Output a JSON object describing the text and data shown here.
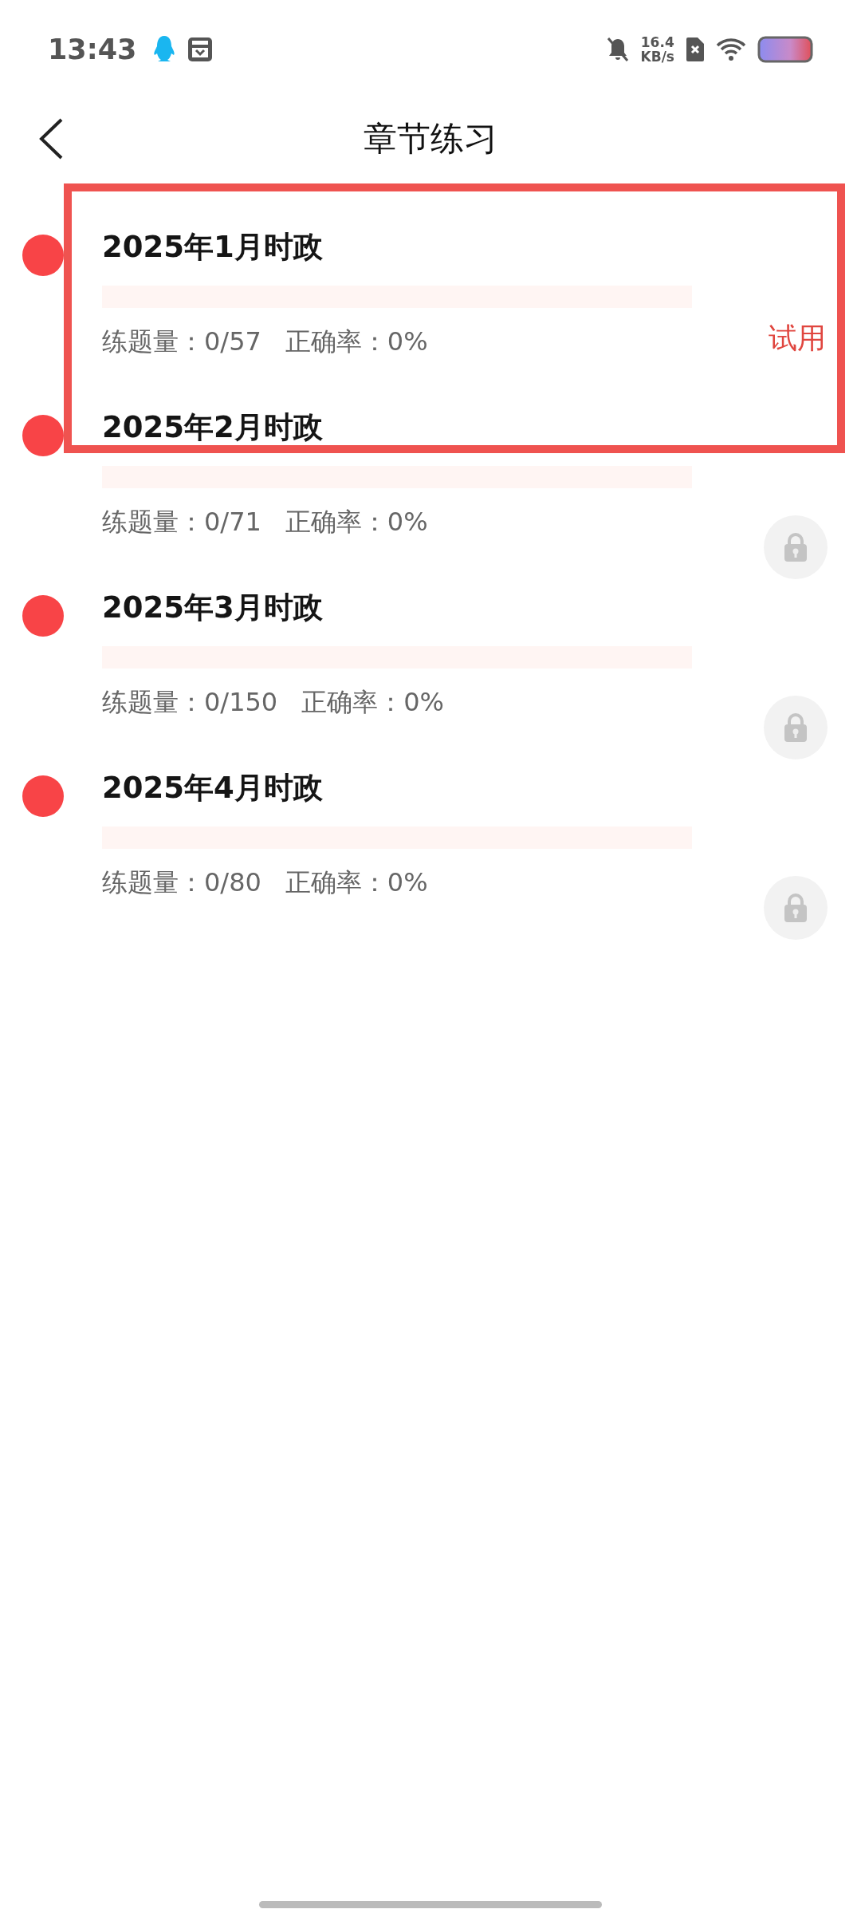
{
  "status_bar": {
    "time": "13:43",
    "net_speed": "16.4",
    "net_unit": "KB/s"
  },
  "header": {
    "title": "章节练习"
  },
  "chapters": [
    {
      "title": "2025年1月时政",
      "level": 0,
      "count_label": "练题量：0/57",
      "accuracy_label": "正确率：0%",
      "kind": "trial",
      "badge": "试用",
      "highlighted": true
    },
    {
      "title": "2025年2月时政",
      "level": 0,
      "count_label": "练题量：0/71",
      "accuracy_label": "正确率：0%",
      "kind": "locked",
      "highlighted": false
    },
    {
      "title": "2025年3月时政",
      "level": 0,
      "count_label": "练题量：0/150",
      "accuracy_label": "正确率：0%",
      "kind": "locked",
      "highlighted": false
    },
    {
      "title": "2025年4月时政",
      "level": 0,
      "count_label": "练题量：0/80",
      "accuracy_label": "正确率：0%",
      "kind": "locked",
      "highlighted": false
    }
  ]
}
